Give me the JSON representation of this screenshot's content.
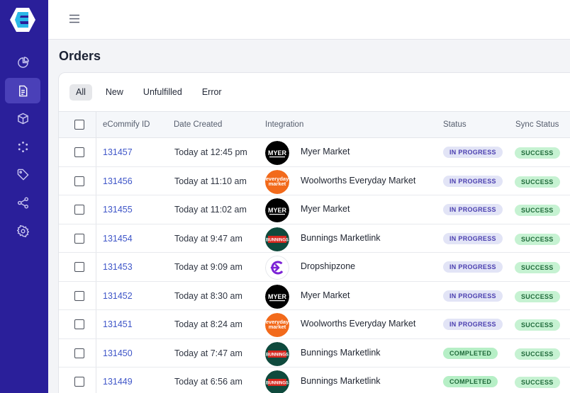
{
  "page": {
    "title": "Orders"
  },
  "sidebar": {
    "items": [
      {
        "icon": "pie-chart-icon",
        "active": false
      },
      {
        "icon": "document-icon",
        "active": true
      },
      {
        "icon": "cube-icon",
        "active": false
      },
      {
        "icon": "circle-nodes-icon",
        "active": false
      },
      {
        "icon": "tag-icon",
        "active": false
      },
      {
        "icon": "share-icon",
        "active": false
      },
      {
        "icon": "settings-icon",
        "active": false
      }
    ]
  },
  "tabs": [
    {
      "label": "All",
      "active": true
    },
    {
      "label": "New",
      "active": false
    },
    {
      "label": "Unfulfilled",
      "active": false
    },
    {
      "label": "Error",
      "active": false
    }
  ],
  "table": {
    "columns": [
      "eCommify ID",
      "Date Created",
      "Integration",
      "Status",
      "Sync Status"
    ],
    "rows": [
      {
        "id": "131457",
        "date": "Today at 12:45 pm",
        "integration": "Myer Market",
        "logo": "myer",
        "status": "IN PROGRESS",
        "sync": "SUCCESS"
      },
      {
        "id": "131456",
        "date": "Today at 11:10 am",
        "integration": "Woolworths Everyday Market",
        "logo": "everyday",
        "status": "IN PROGRESS",
        "sync": "SUCCESS"
      },
      {
        "id": "131455",
        "date": "Today at 11:02 am",
        "integration": "Myer Market",
        "logo": "myer",
        "status": "IN PROGRESS",
        "sync": "SUCCESS"
      },
      {
        "id": "131454",
        "date": "Today at 9:47 am",
        "integration": "Bunnings Marketlink",
        "logo": "bunnings",
        "status": "IN PROGRESS",
        "sync": "SUCCESS"
      },
      {
        "id": "131453",
        "date": "Today at 9:09 am",
        "integration": "Dropshipzone",
        "logo": "dropship",
        "status": "IN PROGRESS",
        "sync": "SUCCESS"
      },
      {
        "id": "131452",
        "date": "Today at 8:30 am",
        "integration": "Myer Market",
        "logo": "myer",
        "status": "IN PROGRESS",
        "sync": "SUCCESS"
      },
      {
        "id": "131451",
        "date": "Today at 8:24 am",
        "integration": "Woolworths Everyday Market",
        "logo": "everyday",
        "status": "IN PROGRESS",
        "sync": "SUCCESS"
      },
      {
        "id": "131450",
        "date": "Today at 7:47 am",
        "integration": "Bunnings Marketlink",
        "logo": "bunnings",
        "status": "COMPLETED",
        "sync": "SUCCESS"
      },
      {
        "id": "131449",
        "date": "Today at 6:56 am",
        "integration": "Bunnings Marketlink",
        "logo": "bunnings",
        "status": "COMPLETED",
        "sync": "SUCCESS"
      }
    ]
  },
  "logos": {
    "myer": "MYER",
    "everyday": "everyday market",
    "bunnings": "BUNNINGS"
  },
  "colors": {
    "sidebar": "#2a1f9a",
    "link": "#3f56c8",
    "in_progress_bg": "#e2e4f6",
    "in_progress_text": "#4b3fb0",
    "completed_bg": "#b6efc6",
    "completed_text": "#1f6a3a",
    "success_bg": "#c6f2d2",
    "success_text": "#1f6a3a"
  }
}
